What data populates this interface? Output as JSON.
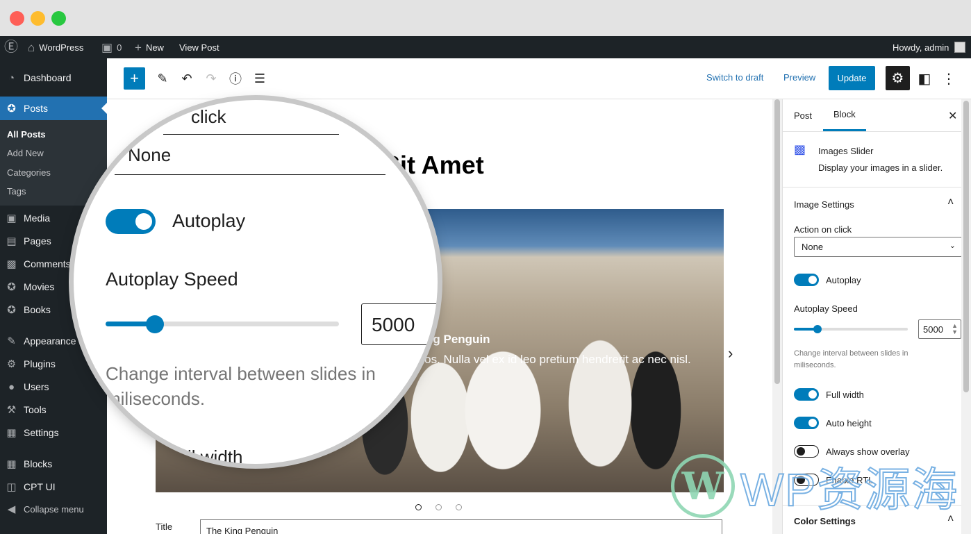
{
  "adminbar": {
    "site_name": "WordPress",
    "comments_count": "0",
    "new_label": "New",
    "view_post": "View Post",
    "howdy": "Howdy, admin"
  },
  "sidebar": {
    "dashboard": "Dashboard",
    "posts": "Posts",
    "submenu": [
      "All Posts",
      "Add New",
      "Categories",
      "Tags"
    ],
    "media": "Media",
    "pages": "Pages",
    "comments": "Comments",
    "movies": "Movies",
    "books": "Books",
    "appearance": "Appearance",
    "plugins": "Plugins",
    "users": "Users",
    "tools": "Tools",
    "settings": "Settings",
    "blocks": "Blocks",
    "cpt_ui": "CPT UI",
    "collapse": "Collapse menu"
  },
  "toolbar": {
    "switch_to_draft": "Switch to draft",
    "preview": "Preview",
    "update": "Update"
  },
  "content": {
    "post_title": "Sit Amet",
    "slide_heading": "King Penguin",
    "slide_text": "eros. Nulla vel ex id leo pretium hendrerit ac nec nisl.",
    "title_label": "Title",
    "title_value": "The King Penguin",
    "active_slide": 1,
    "slide_count": 3
  },
  "magnifier": {
    "click_text": "click",
    "none_text": "None",
    "autoplay": "Autoplay",
    "autoplay_speed": "Autoplay Speed",
    "speed_value": "5000",
    "help_line1": "Change interval between slides in",
    "help_line2": "miliseconds.",
    "full_width": "ll width"
  },
  "panel": {
    "tabs": [
      "Post",
      "Block"
    ],
    "active_tab": "Block",
    "block_name": "Images Slider",
    "block_desc": "Display your images in a slider.",
    "image_settings": "Image Settings",
    "action_on_click": "Action on click",
    "action_value": "None",
    "autoplay": "Autoplay",
    "autoplay_speed": "Autoplay Speed",
    "speed_value": "5000",
    "speed_fraction": 0.21,
    "help": "Change interval between slides in miliseconds.",
    "full_width": "Full width",
    "auto_height": "Auto height",
    "always_show_overlay": "Always show overlay",
    "enable_rtl": "Enable RTL",
    "color_settings": "Color Settings"
  },
  "watermark": {
    "logo_letter": "W",
    "text": "WP资源海"
  },
  "colors": {
    "admin_dark": "#1d2327",
    "accent": "#007cba",
    "sidebar_active": "#2271b1"
  }
}
